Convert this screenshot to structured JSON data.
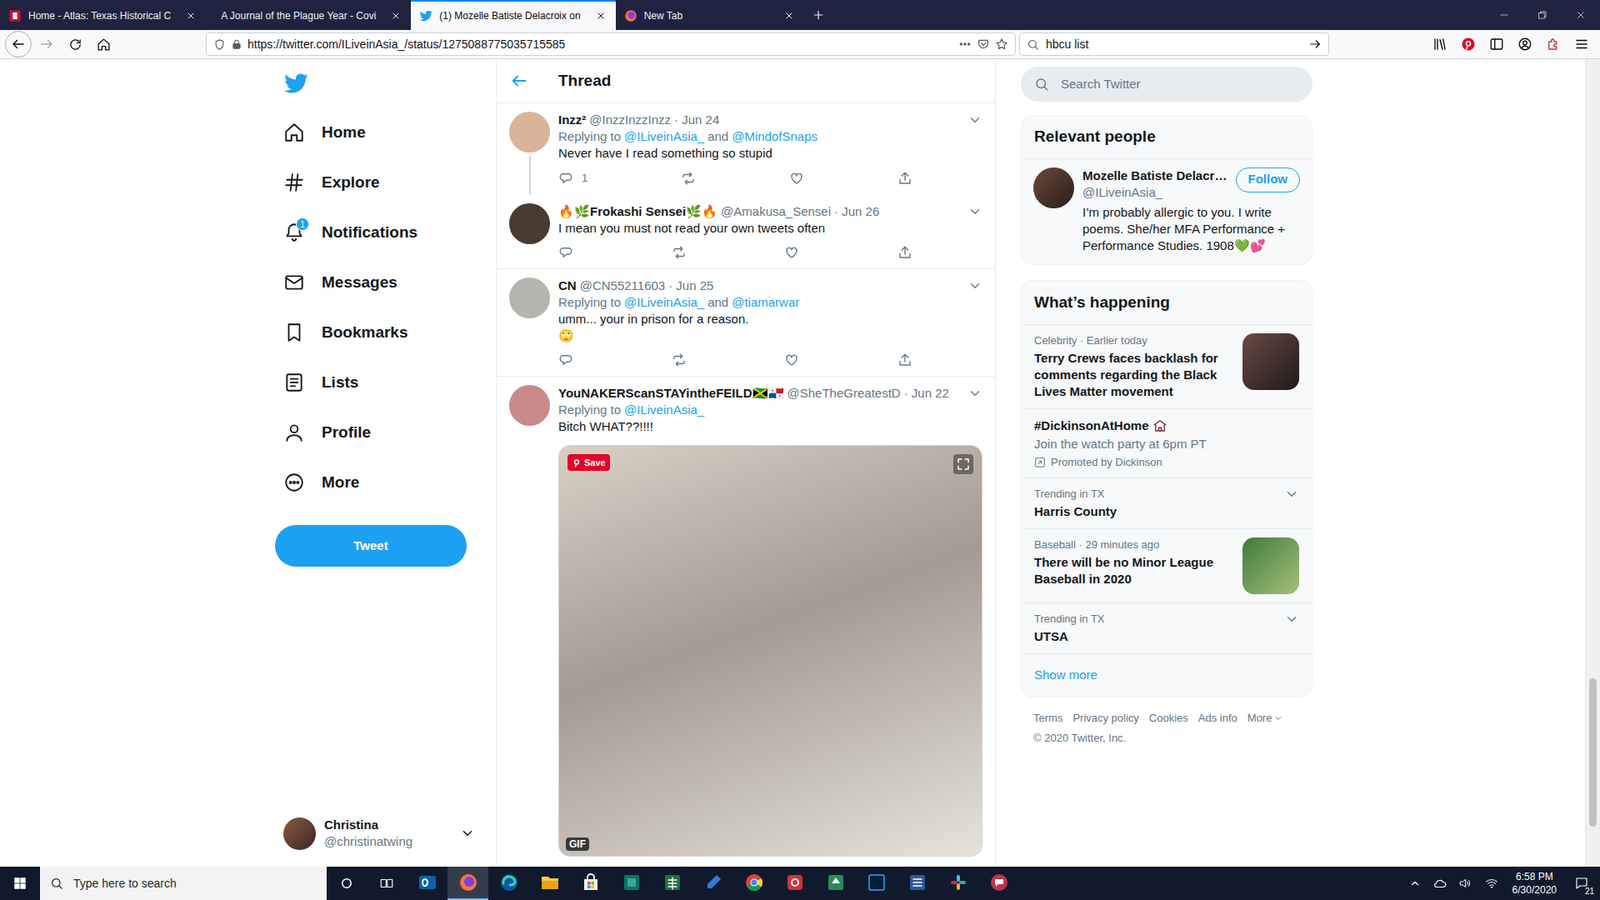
{
  "browser": {
    "tabs": [
      {
        "label": "Home - Atlas: Texas Historical C",
        "selected": false,
        "kind": "atlas"
      },
      {
        "label": "A Journal of the Plague Year - Covi",
        "selected": false,
        "kind": "none"
      },
      {
        "label": "(1) Mozelle Batiste Delacroix on",
        "selected": true,
        "kind": "twitter"
      },
      {
        "label": "New Tab",
        "selected": false,
        "kind": "firefox"
      }
    ],
    "url": "https://twitter.com/ILiveinAsia_/status/1275088775035715585",
    "search": "hbcu list"
  },
  "twitter": {
    "nav": [
      {
        "label": "Home",
        "kind": "home"
      },
      {
        "label": "Explore",
        "kind": "explore"
      },
      {
        "label": "Notifications",
        "kind": "bell",
        "badge": "1"
      },
      {
        "label": "Messages",
        "kind": "mail"
      },
      {
        "label": "Bookmarks",
        "kind": "bookmark"
      },
      {
        "label": "Lists",
        "kind": "lists"
      },
      {
        "label": "Profile",
        "kind": "profile"
      },
      {
        "label": "More",
        "kind": "more"
      }
    ],
    "tweet_button": "Tweet",
    "account": {
      "name": "Christina",
      "handle": "@christinatwing"
    },
    "thread": {
      "title": "Thread",
      "reply_prefix": "Replying to",
      "reply_joiner": "and",
      "tweets": [
        {
          "name": "Inzz²",
          "handle": "@InzzInzzInzz",
          "date": "· Jun 24",
          "reply_to": [
            "@ILiveinAsia_",
            "@MindofSnaps"
          ],
          "text": "Never have I read something so stupid",
          "reply_count": "1",
          "thread_line": true
        },
        {
          "name": "🔥🌿Frokashi Sensei🌿🔥",
          "handle": "@Amakusa_Sensei",
          "date": "· Jun 26",
          "reply_to": [],
          "text": "I mean you must not read your own tweets often",
          "thread_line": false
        },
        {
          "name": "CN",
          "handle": "@CN55211603",
          "date": "· Jun 25",
          "reply_to": [
            "@ILiveinAsia_",
            "@tiamarwar"
          ],
          "text": "umm... your in prison for a reason.\n🙄",
          "thread_line": false
        },
        {
          "name": "YouNAKERScanSTAYintheFEILD🇯🇲🇵🇦",
          "handle": "@SheTheGreatestD",
          "date": "· Jun 22",
          "reply_to": [
            "@ILiveinAsia_"
          ],
          "text": "Bitch WHAT??!!!!",
          "thread_line": false,
          "media": {
            "save": "Save",
            "label": "GIF"
          }
        }
      ]
    },
    "search_placeholder": "Search Twitter",
    "relevant": {
      "title": "Relevant people",
      "name": "Mozelle Batiste Delacr…",
      "handle": "@ILiveinAsia_",
      "button": "Follow",
      "bio": "I’m probably allergic to you. I write poems. She/her MFA Performance + Performance Studies. 1908💚💕"
    },
    "happening": {
      "title": "What’s happening",
      "items": [
        {
          "kind": "image",
          "meta": "Celebrity · Earlier today",
          "title": "Terry Crews faces backlash for comments regarding the Black Lives Matter movement"
        },
        {
          "kind": "promoted",
          "title": "#DickinsonAtHome",
          "desc": "Join the watch party at 6pm PT",
          "promoted": "Promoted by Dickinson"
        },
        {
          "kind": "trend",
          "meta": "Trending in TX",
          "title": "Harris County"
        },
        {
          "kind": "image",
          "meta": "Baseball · 29 minutes ago",
          "title": "There will be no Minor League Baseball in 2020"
        },
        {
          "kind": "trend",
          "meta": "Trending in TX",
          "title": "UTSA"
        }
      ],
      "more": "Show more"
    },
    "footer": {
      "links": [
        "Terms",
        "Privacy policy",
        "Cookies",
        "Ads info",
        "More"
      ],
      "copyright": "© 2020 Twitter, Inc."
    }
  },
  "taskbar": {
    "search_placeholder": "Type here to search",
    "apps": [
      {
        "kind": "outlook",
        "active": false
      },
      {
        "kind": "firefox",
        "active": true
      },
      {
        "kind": "edge",
        "active": false
      },
      {
        "kind": "explorer",
        "active": false
      },
      {
        "kind": "store",
        "active": false
      },
      {
        "kind": "publisher",
        "active": false
      },
      {
        "kind": "excel",
        "active": false
      },
      {
        "kind": "pen",
        "active": false
      },
      {
        "kind": "chrome",
        "active": false
      },
      {
        "kind": "red",
        "active": false
      },
      {
        "kind": "green",
        "active": false
      },
      {
        "kind": "photoshop",
        "active": false
      },
      {
        "kind": "word",
        "active": false
      },
      {
        "kind": "slack",
        "active": false
      },
      {
        "kind": "chat",
        "active": false
      }
    ],
    "time": "6:58 PM",
    "date": "6/30/2020",
    "notifications": "21"
  }
}
